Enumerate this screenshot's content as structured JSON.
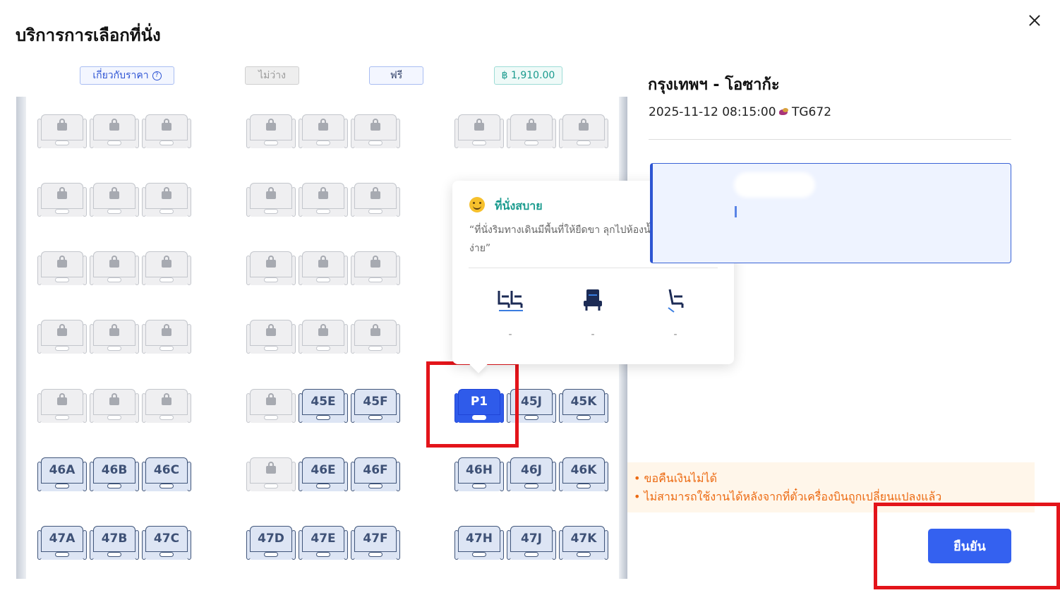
{
  "dialog": {
    "title": "บริการการเลือกที่นั่ง"
  },
  "legend": {
    "info": "เกี่ยวกับราคา",
    "unavailable": "ไม่ว่าง",
    "free": "ฟรี",
    "price": "฿ 1,910.00"
  },
  "seats": {
    "45E": "45E",
    "45F": "45F",
    "P1": "P1",
    "45J": "45J",
    "45K": "45K",
    "46A": "46A",
    "46B": "46B",
    "46C": "46C",
    "46E": "46E",
    "46F": "46F",
    "46H": "46H",
    "46J": "46J",
    "46K": "46K",
    "47A": "47A",
    "47B": "47B",
    "47C": "47C",
    "47D": "47D",
    "47E": "47E",
    "47F": "47F",
    "47H": "47H",
    "47J": "47J",
    "47K": "47K"
  },
  "tooltip": {
    "title": "ที่นั่งสบาย",
    "description": "“ที่นั่งริมทางเดินมีพื้นที่ให้ยืดขา ลุกไปห้องน้ำและเดินไปมาง่าย”",
    "features": [
      {
        "icon": "legroom-seat-icon",
        "value": "-"
      },
      {
        "icon": "seat-width-icon",
        "value": "-"
      },
      {
        "icon": "recline-seat-icon",
        "value": "-"
      }
    ]
  },
  "flight": {
    "route": "กรุงเทพฯ - โอซาก้ะ",
    "datetime": "2025-11-12 08:15:00",
    "number": "TG672"
  },
  "notice": {
    "lines": [
      "• ขอคืนเงินไม่ได้",
      "• ไม่สามารถใช้งานได้หลังจากที่ตั๋วเครื่องบินถูกเปลี่ยนแปลงแล้ว"
    ]
  },
  "actions": {
    "confirm": "ยืนยัน"
  },
  "colors": {
    "accent": "#3461f0",
    "selected_seat": "#2f5bea",
    "price_green": "#1a9b8e",
    "warning": "#ec6a12",
    "highlight": "#e3141a"
  }
}
